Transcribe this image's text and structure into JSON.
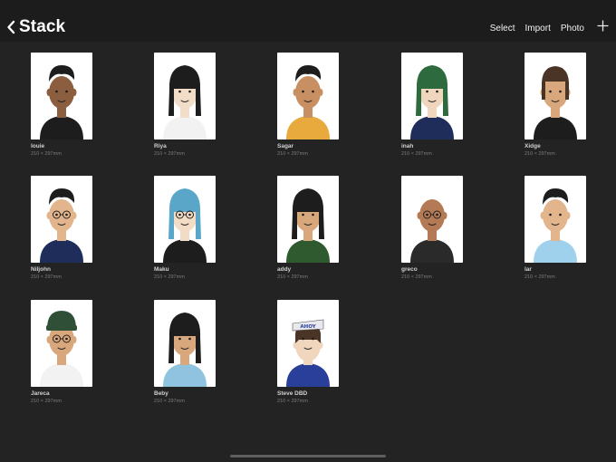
{
  "header": {
    "back_label": "Stack",
    "actions": {
      "select": "Select",
      "import": "Import",
      "photo": "Photo"
    },
    "back_icon": "chevron-left-icon",
    "add_icon": "plus-icon"
  },
  "artworks": [
    {
      "name": "louie",
      "size": "210 × 297mm",
      "skin": "#8a5e3e",
      "hair": "#1d1d1d",
      "shirt": "#1d1d1d",
      "hair_style": "short"
    },
    {
      "name": "Riya",
      "size": "210 × 297mm",
      "skin": "#f2ddc8",
      "hair": "#1d1d1d",
      "shirt": "#f2f2f2",
      "hair_style": "long"
    },
    {
      "name": "Sagar",
      "size": "210 × 297mm",
      "skin": "#c89062",
      "hair": "#1d1d1d",
      "shirt": "#e8a93d",
      "hair_style": "short"
    },
    {
      "name": "inah",
      "size": "210 × 297mm",
      "skin": "#f0d6bc",
      "hair": "#2d6a3d",
      "shirt": "#1e2d5a",
      "hair_style": "long"
    },
    {
      "name": "Xidge",
      "size": "210 × 297mm",
      "skin": "#d9a77c",
      "hair": "#4a3426",
      "shirt": "#1d1d1d",
      "hair_style": "medium"
    },
    {
      "name": "Niljohn",
      "size": "210 × 297mm",
      "skin": "#e2b58d",
      "hair": "#1d1d1d",
      "shirt": "#1e2d5a",
      "hair_style": "short",
      "glasses": true
    },
    {
      "name": "Maku",
      "size": "210 × 297mm",
      "skin": "#f2dcc6",
      "hair": "#5aa6c8",
      "shirt": "#1d1d1d",
      "hair_style": "long",
      "glasses": true
    },
    {
      "name": "addy",
      "size": "210 × 297mm",
      "skin": "#d9a77c",
      "hair": "#1d1d1d",
      "shirt": "#2f5a2f",
      "hair_style": "long"
    },
    {
      "name": "greco",
      "size": "210 × 297mm",
      "skin": "#b37a55",
      "hair": "#b37a55",
      "shirt": "#2a2a2a",
      "hair_style": "bald",
      "glasses": true
    },
    {
      "name": "lar",
      "size": "210 × 297mm",
      "skin": "#e2b58d",
      "hair": "#1d1d1d",
      "shirt": "#9fd0ec",
      "hair_style": "short"
    },
    {
      "name": "Jareca",
      "size": "210 × 297mm",
      "skin": "#d9a77c",
      "hair": "#2f4f37",
      "shirt": "#f2f2f2",
      "hair_style": "beanie",
      "glasses": true
    },
    {
      "name": "Beby",
      "size": "210 × 297mm",
      "skin": "#d9a77c",
      "hair": "#1d1d1d",
      "shirt": "#8fc3e0",
      "hair_style": "long"
    },
    {
      "name": "Steve DBD",
      "size": "210 × 297mm",
      "skin": "#f0d6bc",
      "hair": "#4a3426",
      "shirt": "#2a3f9a",
      "hair_style": "hat",
      "hat_text": "AHOY"
    }
  ]
}
